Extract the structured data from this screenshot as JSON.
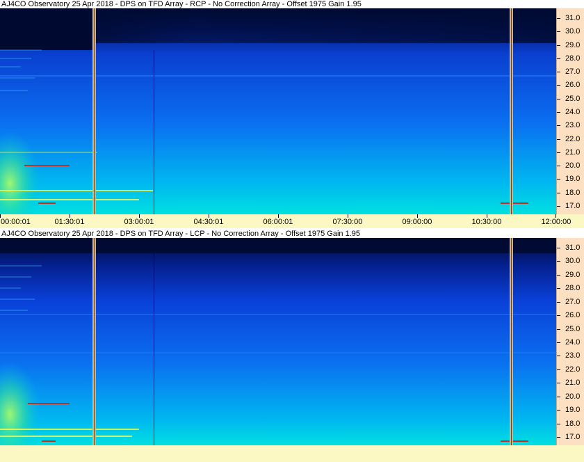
{
  "panels": [
    {
      "id": "rcp",
      "title": "AJ4CO Observatory 25 Apr 2018 - DPS on TFD Array  - RCP  -  No Correction Array  -  Offset 1975  Gain 1.95",
      "x_labels": [
        "00:00:01",
        "01:30:01",
        "03:00:01",
        "04:30:01",
        "06:00:01",
        "07:30:00",
        "09:00:00",
        "10:30:00",
        "12:00:00"
      ]
    },
    {
      "id": "lcp",
      "title": "AJ4CO Observatory 25 Apr 2018 - DPS on TFD Array  - LCP  -  No Correction Array  -  Offset 1975  Gain 1.95",
      "x_labels": []
    }
  ],
  "y_labels": [
    "31.0",
    "30.0",
    "29.0",
    "28.0",
    "27.0",
    "26.0",
    "25.0",
    "24.0",
    "23.0",
    "22.0",
    "21.0",
    "20.0",
    "19.0",
    "18.0",
    "17.0"
  ],
  "colors": {
    "spectrogram_base": "#1a4fe0",
    "spectrogram_low": "#00e0e0",
    "spectrogram_top": "#000a30",
    "axis_freq_bg": "#fde0c2",
    "axis_time_bg": "#fbf8c4"
  }
}
